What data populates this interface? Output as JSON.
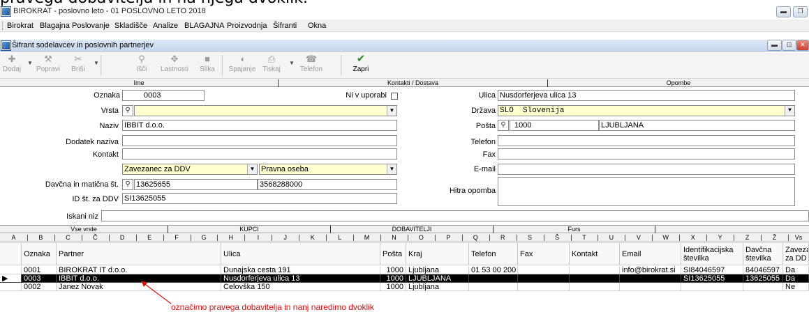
{
  "top_text": "pravega dobavitelja in na njega dvoklik.",
  "app": {
    "title": "BIROKRAT - poslovno leto - 01 POSLOVNO LETO 2018"
  },
  "menu": [
    "Birokrat",
    "Blagajna",
    "Poslovanje",
    "Skladišče",
    "Analize",
    "BLAGAJNA",
    "Proizvodnja",
    "Šifranti",
    "Okna"
  ],
  "child_window": {
    "title": "Šifrant sodelavcev in poslovnih partnerjev"
  },
  "toolbar": [
    {
      "label": "Dodaj",
      "icon": "plus-icon"
    },
    {
      "label": "Popravi",
      "icon": "hammer-icon"
    },
    {
      "label": "Briši",
      "icon": "scissors-icon"
    },
    {
      "label": "Išči",
      "icon": "search-icon"
    },
    {
      "label": "Lastnosti",
      "icon": "properties-icon"
    },
    {
      "label": "Slika",
      "icon": "image-icon"
    },
    {
      "label": "Spajanje",
      "icon": "merge-icon"
    },
    {
      "label": "Tiskaj",
      "icon": "printer-icon"
    },
    {
      "label": "Telefon",
      "icon": "phone-icon"
    },
    {
      "label": "Zapri",
      "icon": "checkmark-icon"
    }
  ],
  "header_tabs": [
    "Ime",
    "Kontakti / Dostava",
    "Opombe"
  ],
  "form": {
    "oznaka_label": "Oznaka",
    "oznaka": "0003",
    "ni_v_uporabi_label": "Ni v uporabi",
    "vrsta_label": "Vrsta",
    "vrsta": "",
    "naziv_label": "Naziv",
    "naziv": "IBBIT d.o.o.",
    "dodatek_label": "Dodatek naziva",
    "dodatek": "",
    "kontakt_label": "Kontakt",
    "kontakt": "",
    "zavezanec": "Zavezanec za DDV",
    "oseba": "Pravna oseba",
    "davcna_label": "Davčna in matična št.",
    "davcna": "13625655",
    "maticna": "3568288000",
    "id_ddv_label": "ID št. za DDV",
    "id_ddv": "SI13625055",
    "ulica_label": "Ulica",
    "ulica": "Nusdorferjeva ulica 13",
    "drzava_label": "Država",
    "drzava_code": "SLO",
    "drzava": "Slovenija",
    "posta_label": "Pošta",
    "posta": "1000",
    "kraj": "LJUBLJANA",
    "telefon_label": "Telefon",
    "telefon": "",
    "fax_label": "Fax",
    "fax": "",
    "email_label": "E-mail",
    "email": "",
    "hitra_label": "Hitra opomba",
    "hitra": "",
    "iskani_label": "Iskani niz",
    "iskani": ""
  },
  "lower_tabs": [
    "Vse vrste",
    "KUPCI",
    "DOBAVITELJI",
    "Furs"
  ],
  "letters": [
    "A",
    "B",
    "C",
    "Č",
    "D",
    "E",
    "F",
    "G",
    "H",
    "I",
    "J",
    "K",
    "L",
    "M",
    "N",
    "O",
    "P",
    "Q",
    "R",
    "S",
    "Š",
    "T",
    "U",
    "V",
    "W",
    "X",
    "Y",
    "Z",
    "Ž",
    "Vs"
  ],
  "grid": {
    "headers": [
      "Oznaka",
      "Partner",
      "Ulica",
      "Pošta",
      "Kraj",
      "Telefon",
      "Fax",
      "Kontakt",
      "Email",
      "Identifikacijska številka",
      "Davčna številka",
      "Zaveza za DD"
    ],
    "rows": [
      [
        "0001",
        "BIROKRAT IT d.o.o.",
        "Dunajska cesta 191",
        "1000",
        "Ljubljana",
        "01 53 00 200",
        "",
        "",
        "info@birokrat.si",
        "SI84046597",
        "84046597",
        "Da"
      ],
      [
        "0003",
        "IBBIT d.o.o.",
        "Nusdorferjeva ulica 13",
        "1000",
        "LJUBLJANA",
        "",
        "",
        "",
        "",
        "SI13625055",
        "13625055",
        "Da"
      ],
      [
        "0002",
        "Janez Novak",
        "Celovška 150",
        "1000",
        "Ljubljana",
        "",
        "",
        "",
        "",
        "",
        "",
        "Ne"
      ]
    ],
    "selected_row": 1
  },
  "annotation": "označimo pravega dobavitelja in nanj naredimo dvoklik",
  "colors": {
    "annotation": "#e01010",
    "selected_row": "#000000",
    "required_field": "#ffffd0",
    "zapri_icon": "#2a8a2a"
  }
}
